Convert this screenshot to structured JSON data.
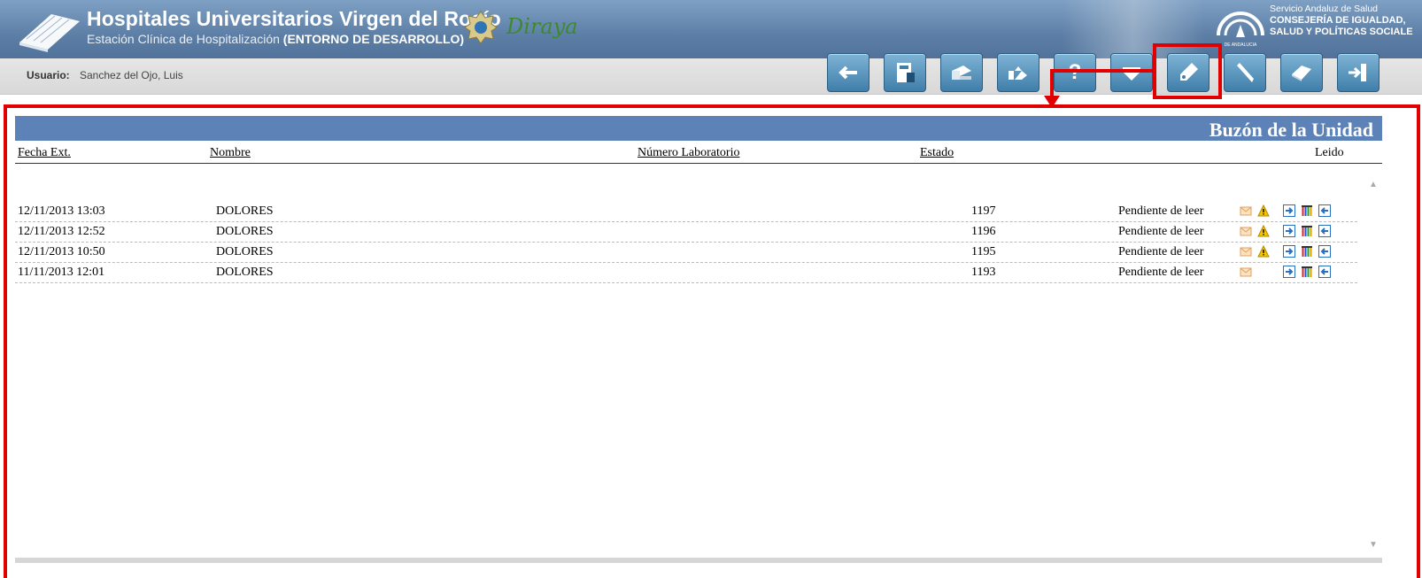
{
  "header": {
    "hospital_title": "Hospitales Universitarios Virgen del Rocío",
    "subtitle_prefix": "Estación Clínica de Hospitalización ",
    "subtitle_env": "(ENTORNO DE DESARROLLO)",
    "app_name": "Diraya",
    "sas_line1": "Servicio Andaluz de Salud",
    "sas_line2": "CONSEJERÍA DE IGUALDAD,",
    "sas_line3": "SALUD Y POLÍTICAS SOCIALE",
    "junta_small": "DE ANDALUCIA"
  },
  "userbar": {
    "user_label": "Usuario:",
    "user_name": "Sanchez del Ojo, Luis"
  },
  "toolbar": {
    "buttons": [
      {
        "icon": "back-arrow-icon"
      },
      {
        "icon": "medical-record-icon"
      },
      {
        "icon": "bed-icon"
      },
      {
        "icon": "transfer-icon"
      },
      {
        "icon": "help-icon",
        "label": "?"
      },
      {
        "icon": "dropdown-icon"
      },
      {
        "icon": "lab-tube-icon"
      },
      {
        "icon": "pen-icon"
      },
      {
        "icon": "book-icon"
      },
      {
        "icon": "exit-icon"
      }
    ]
  },
  "panel": {
    "title": "Buzón de la Unidad",
    "columns": {
      "fecha": "Fecha Ext.",
      "nombre": "Nombre",
      "numero": "Número Laboratorio",
      "estado": "Estado",
      "leido": "Leido"
    },
    "rows": [
      {
        "fecha": "12/11/2013 13:03",
        "nombre": "DOLORES",
        "numero": "1197",
        "estado": "Pendiente de leer",
        "warning": true
      },
      {
        "fecha": "12/11/2013 12:52",
        "nombre": "DOLORES",
        "numero": "1196",
        "estado": "Pendiente de leer",
        "warning": true
      },
      {
        "fecha": "12/11/2013 10:50",
        "nombre": "DOLORES",
        "numero": "1195",
        "estado": "Pendiente de leer",
        "warning": true
      },
      {
        "fecha": "11/11/2013 12:01",
        "nombre": "DOLORES",
        "numero": "1193",
        "estado": "Pendiente de leer",
        "warning": false
      }
    ]
  },
  "colors": {
    "header_blue": "#5d7fa6",
    "panel_blue": "#5c82b8",
    "annotation_red": "#e00000",
    "button_blue": "#3f7ea9"
  }
}
